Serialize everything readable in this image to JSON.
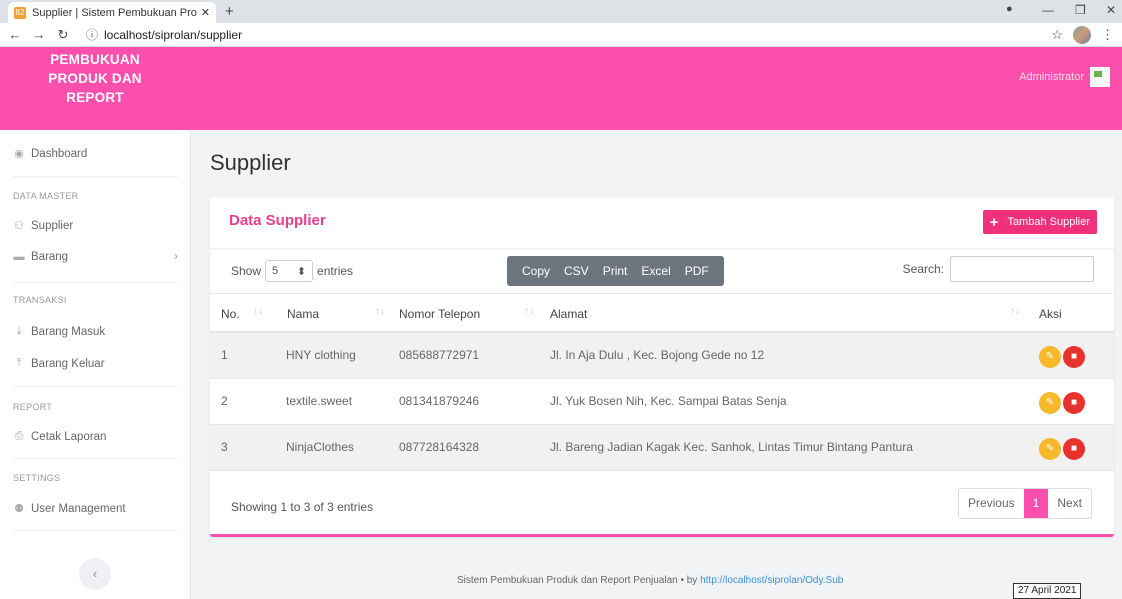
{
  "browser": {
    "tab_title": "Supplier | Sistem Pembukuan Pro",
    "tab_favicon": "82",
    "new_tab": "+",
    "url": "localhost/siprolan/supplier"
  },
  "header": {
    "brand": "PEMBUKUAN PRODUK DAN REPORT",
    "user": "Administrator",
    "color": "#fb4fae"
  },
  "sidebar": {
    "dashboard": "Dashboard",
    "section_master": "DATA MASTER",
    "supplier": "Supplier",
    "barang": "Barang",
    "section_transaksi": "TRANSAKSI",
    "barang_masuk": "Barang Masuk",
    "barang_keluar": "Barang Keluar",
    "section_report": "REPORT",
    "cetak_laporan": "Cetak Laporan",
    "section_settings": "SETTINGS",
    "user_management": "User Management"
  },
  "main": {
    "page_title": "Supplier",
    "card_title": "Data Supplier",
    "add_button": "Tambah Supplier",
    "show_label": "Show",
    "entries_value": "5",
    "entries_label": "entries",
    "export_buttons": [
      "Copy",
      "CSV",
      "Print",
      "Excel",
      "PDF"
    ],
    "search_label": "Search:",
    "columns": [
      "No.",
      "Nama",
      "Nomor Telepon",
      "Alamat",
      "Aksi"
    ],
    "rows": [
      {
        "no": "1",
        "nama": "HNY clothing",
        "telepon": "085688772971",
        "alamat": "Jl. In Aja Dulu , Kec. Bojong Gede no 12"
      },
      {
        "no": "2",
        "nama": "textile.sweet",
        "telepon": "081341879246",
        "alamat": "Jl. Yuk Bosen Nih, Kec. Sampai Batas Senja"
      },
      {
        "no": "3",
        "nama": "NinjaClothes",
        "telepon": "087728164328",
        "alamat": "Jl. Bareng Jadian Kagak Kec. Sanhok, Lintas Timur Bintang Pantura"
      }
    ],
    "info": "Showing 1 to 3 of 3 entries",
    "pager": {
      "prev": "Previous",
      "page": "1",
      "next": "Next"
    }
  },
  "footer": {
    "text": "Sistem Pembukuan Produk dan Report Penjualan • by ",
    "link": "http://localhost/siprolan/Ody.Sub",
    "date": "27 April 2021"
  }
}
